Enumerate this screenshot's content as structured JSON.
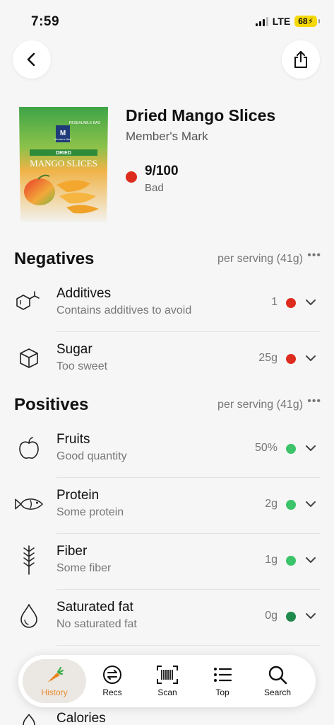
{
  "status": {
    "time": "7:59",
    "network": "LTE",
    "battery": "68"
  },
  "product": {
    "title": "Dried Mango Slices",
    "brand": "Member's Mark",
    "score": "9/100",
    "score_label": "Bad",
    "score_color": "#dd2c1e",
    "package": {
      "top_label": "RESEALABLE BAG",
      "logo": "Member's Mark",
      "band": "DRIED",
      "name": "MANGO SLICES"
    }
  },
  "negatives": {
    "title": "Negatives",
    "per_serving": "per serving (41g)",
    "more": "•••",
    "items": [
      {
        "name": "Additives",
        "desc": "Contains additives to avoid",
        "value": "1",
        "color": "#dd2c1e",
        "icon": "additives-icon"
      },
      {
        "name": "Sugar",
        "desc": "Too sweet",
        "value": "25g",
        "color": "#dd2c1e",
        "icon": "cube-icon"
      }
    ]
  },
  "positives": {
    "title": "Positives",
    "per_serving": "per serving (41g)",
    "more": "•••",
    "items": [
      {
        "name": "Fruits",
        "desc": "Good quantity",
        "value": "50%",
        "color": "#3cc46a",
        "icon": "apple-icon"
      },
      {
        "name": "Protein",
        "desc": "Some protein",
        "value": "2g",
        "color": "#3cc46a",
        "icon": "fish-icon"
      },
      {
        "name": "Fiber",
        "desc": "Some fiber",
        "value": "1g",
        "color": "#3cc46a",
        "icon": "wheat-icon"
      },
      {
        "name": "Saturated fat",
        "desc": "No saturated fat",
        "value": "0g",
        "color": "#1f8a4c",
        "icon": "drop-icon"
      }
    ]
  },
  "peek": {
    "name": "Calories"
  },
  "tabs": [
    {
      "label": "History",
      "icon": "carrot-icon",
      "active": true
    },
    {
      "label": "Recs",
      "icon": "exchange-icon"
    },
    {
      "label": "Scan",
      "icon": "barcode-icon"
    },
    {
      "label": "Top",
      "icon": "list-icon"
    },
    {
      "label": "Search",
      "icon": "search-icon"
    }
  ]
}
